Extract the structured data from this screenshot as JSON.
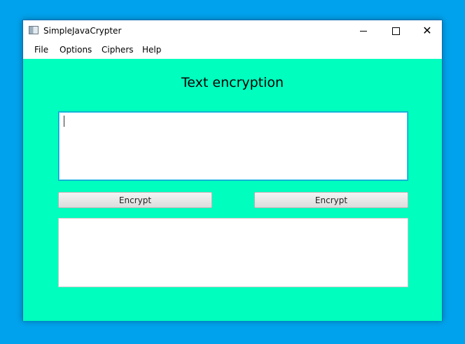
{
  "window": {
    "title": "SimpleJavaCrypter",
    "controls": {
      "minimize": "minimize-icon",
      "maximize": "maximize-icon",
      "close": "close-icon",
      "close_glyph": "✕"
    }
  },
  "menu": {
    "items": [
      "File",
      "Options",
      "Ciphers",
      "Help"
    ]
  },
  "main": {
    "heading": "Text encryption",
    "input_text": "",
    "output_text": "",
    "buttons": {
      "left_label": "Encrypt",
      "right_label": "Encrypt"
    },
    "background_color": "#00ffbf"
  }
}
